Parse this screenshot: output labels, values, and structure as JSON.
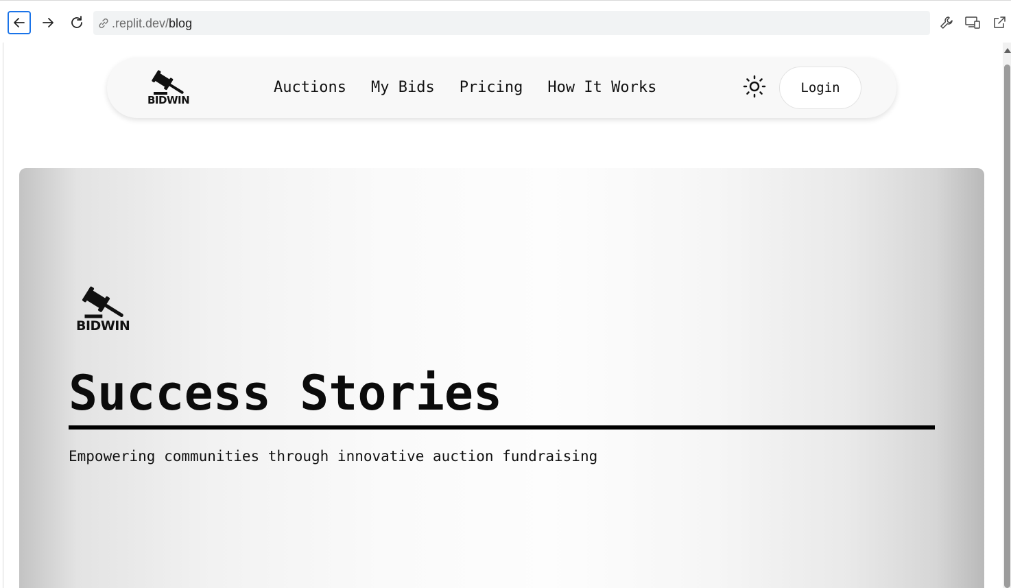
{
  "browser": {
    "url_domain": ".replit.dev/",
    "url_path": "blog",
    "icons": [
      "back-arrow-icon",
      "forward-arrow-icon",
      "reload-icon",
      "link-icon",
      "wrench-icon",
      "devices-icon",
      "open-external-icon"
    ]
  },
  "nav": {
    "brand": "BIDWIN",
    "links": [
      "Auctions",
      "My Bids",
      "Pricing",
      "How It Works"
    ],
    "theme_icon": "sun-icon",
    "login_label": "Login"
  },
  "hero": {
    "brand": "BIDWIN",
    "title": "Success Stories",
    "subtitle": "Empowering communities through innovative auction fundraising"
  }
}
